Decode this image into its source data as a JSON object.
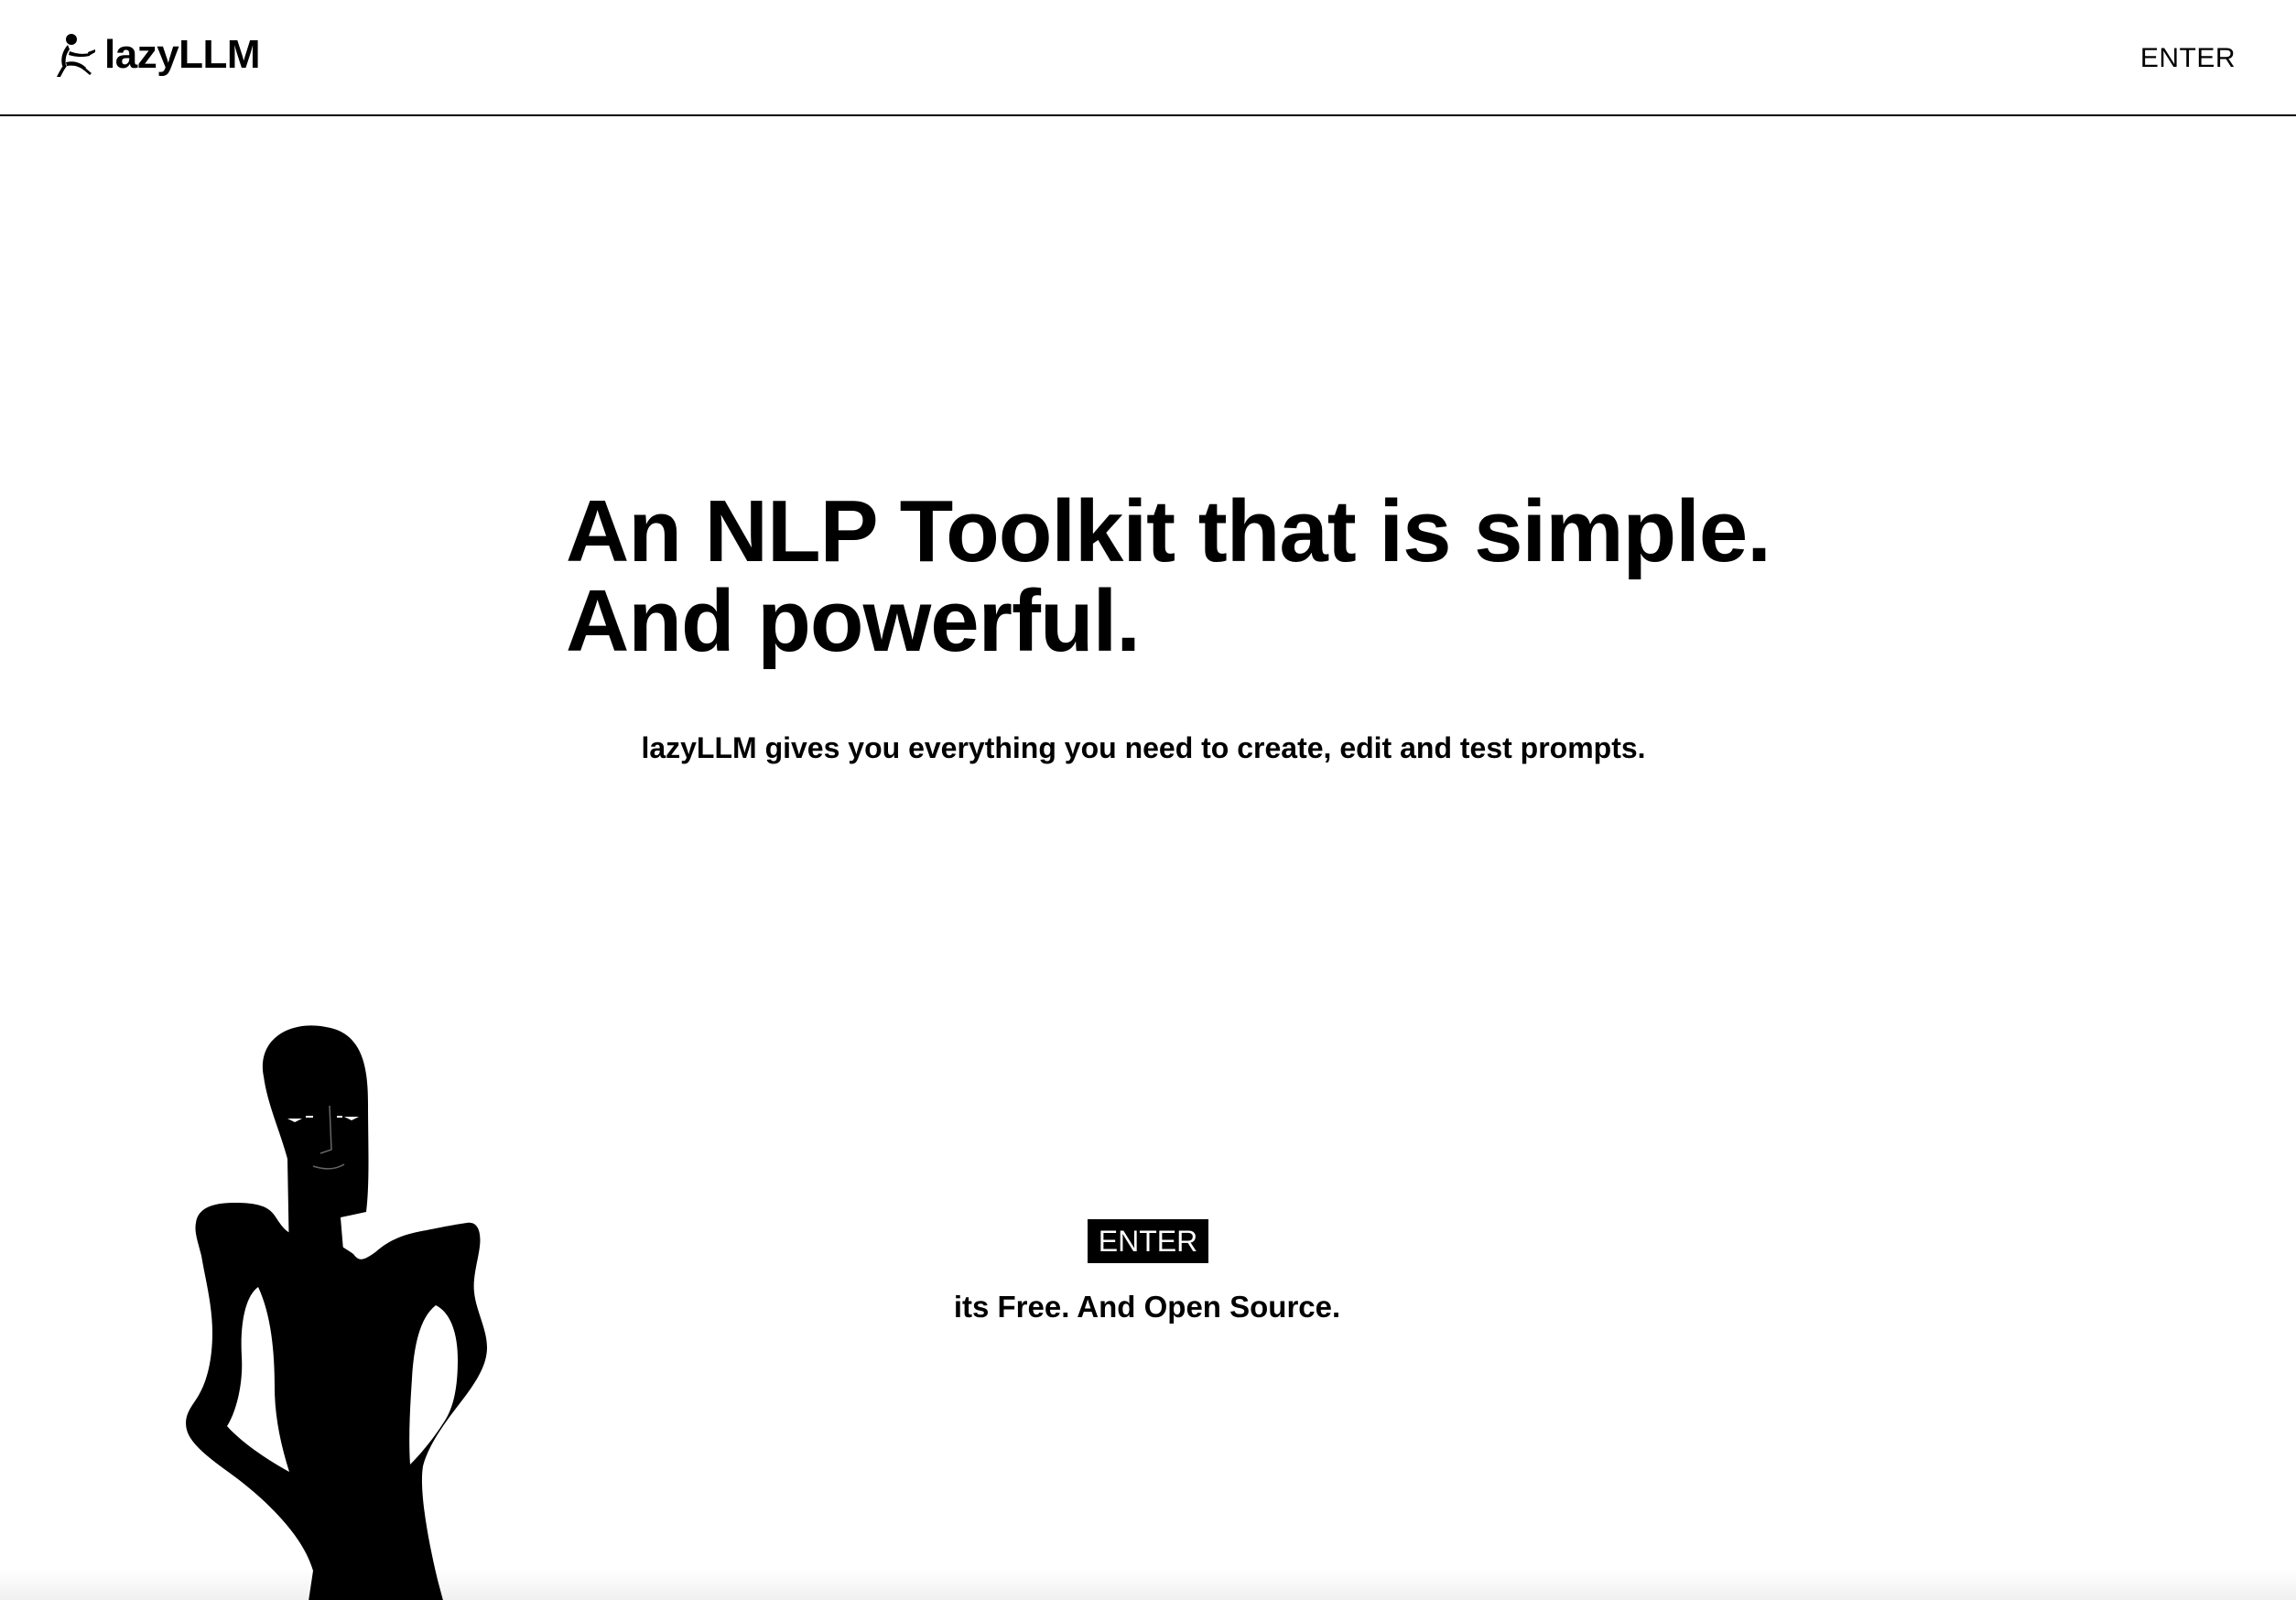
{
  "header": {
    "brand_name": "lazyLLM",
    "brand_icon": "lounging-figure-logo-icon",
    "nav_enter_label": "ENTER"
  },
  "hero": {
    "title_line1": "An NLP Toolkit that is simple.",
    "title_line2": "And powerful.",
    "subtitle": "lazyLLM gives you everything you need to create, edit and test prompts."
  },
  "cta": {
    "button_label": "ENTER",
    "note": "its Free. And Open Source."
  },
  "illustration": {
    "icon": "standing-figure-illustration"
  },
  "colors": {
    "background": "#ffffff",
    "text": "#000000",
    "button_bg": "#000000",
    "button_text": "#ffffff"
  }
}
